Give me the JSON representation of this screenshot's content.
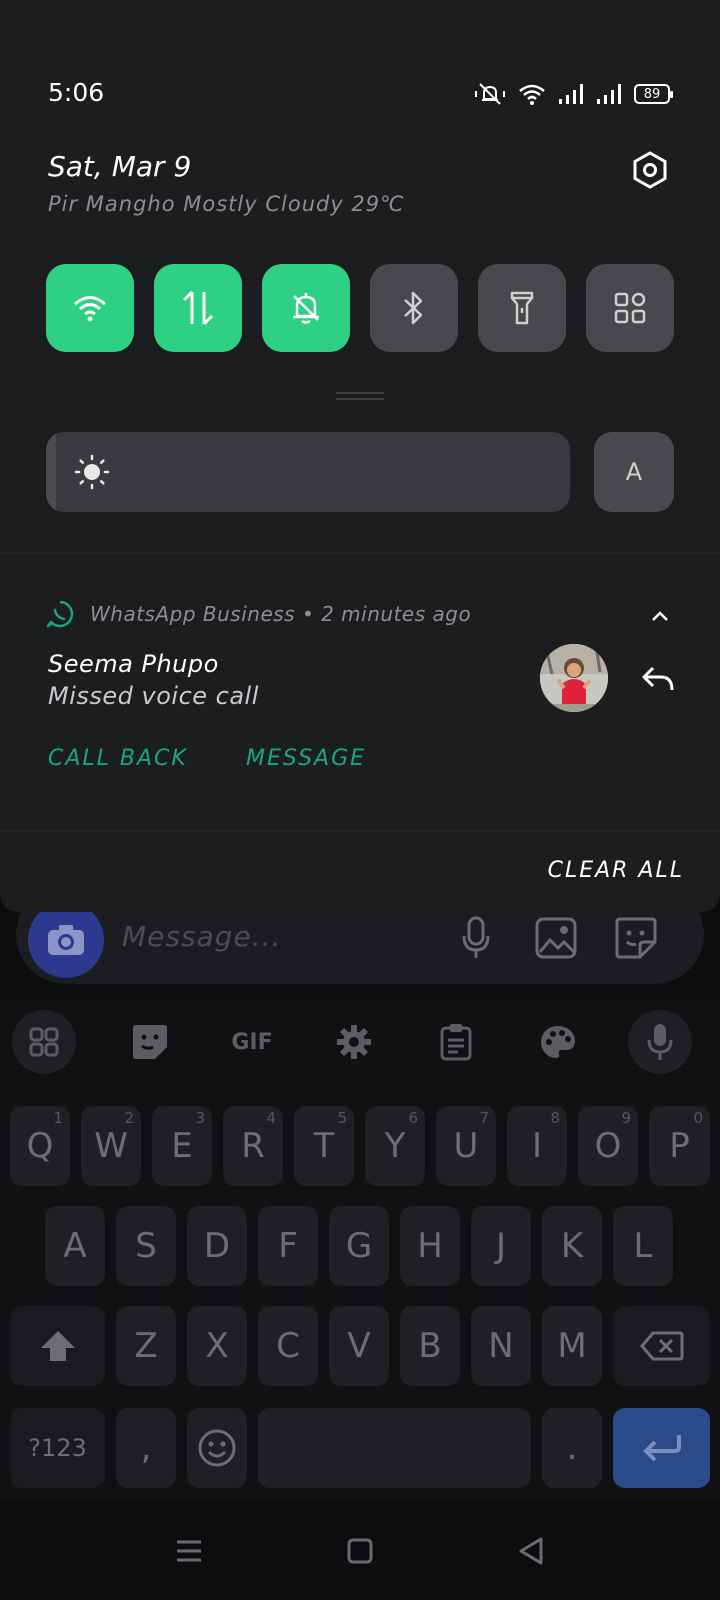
{
  "status_bar": {
    "time": "5:06",
    "battery": "89",
    "icons": [
      "mute-vibrate-icon",
      "wifi-icon",
      "signal-1-icon",
      "signal-2-icon",
      "battery-icon"
    ]
  },
  "header": {
    "date": "Sat, Mar 9",
    "weather": "Pir Mangho Mostly Cloudy 29℃"
  },
  "quick_tiles": [
    {
      "name": "wifi",
      "icon": "wifi-icon",
      "active": true
    },
    {
      "name": "mobile-data",
      "icon": "data-arrows-icon",
      "active": true
    },
    {
      "name": "mute",
      "icon": "bell-off-icon",
      "active": true
    },
    {
      "name": "bluetooth",
      "icon": "bluetooth-icon",
      "active": false
    },
    {
      "name": "flashlight",
      "icon": "flashlight-icon",
      "active": false
    },
    {
      "name": "more",
      "icon": "grid-icon",
      "active": false
    }
  ],
  "brightness": {
    "level": 0.02,
    "auto_label": "A"
  },
  "notification": {
    "app_line": "WhatsApp Business • 2 minutes ago",
    "sender": "Seema Phupo",
    "message": "Missed voice call",
    "actions": [
      "CALL BACK",
      "MESSAGE"
    ]
  },
  "clear_all": "CLEAR ALL",
  "message_bar": {
    "placeholder": "Message..."
  },
  "keyboard": {
    "toolbar": [
      "apps-icon",
      "sticker-icon",
      "GIF",
      "gear-icon",
      "clipboard-icon",
      "palette-icon",
      "mic-icon"
    ],
    "row1": [
      "Q",
      "W",
      "E",
      "R",
      "T",
      "Y",
      "U",
      "I",
      "O",
      "P"
    ],
    "row1_digits": [
      "1",
      "2",
      "3",
      "4",
      "5",
      "6",
      "7",
      "8",
      "9",
      "0"
    ],
    "row2": [
      "A",
      "S",
      "D",
      "F",
      "G",
      "H",
      "J",
      "K",
      "L"
    ],
    "row3": [
      "Z",
      "X",
      "C",
      "V",
      "B",
      "N",
      "M"
    ],
    "symbols_label": "?123",
    "comma": ",",
    "period": "."
  },
  "colors": {
    "accent_green": "#2ed183",
    "whatsapp_green": "#19a67e",
    "tile_off": "#48494c",
    "shade_bg": "#1c1d1f",
    "enter_blue": "#2b4a8a"
  }
}
